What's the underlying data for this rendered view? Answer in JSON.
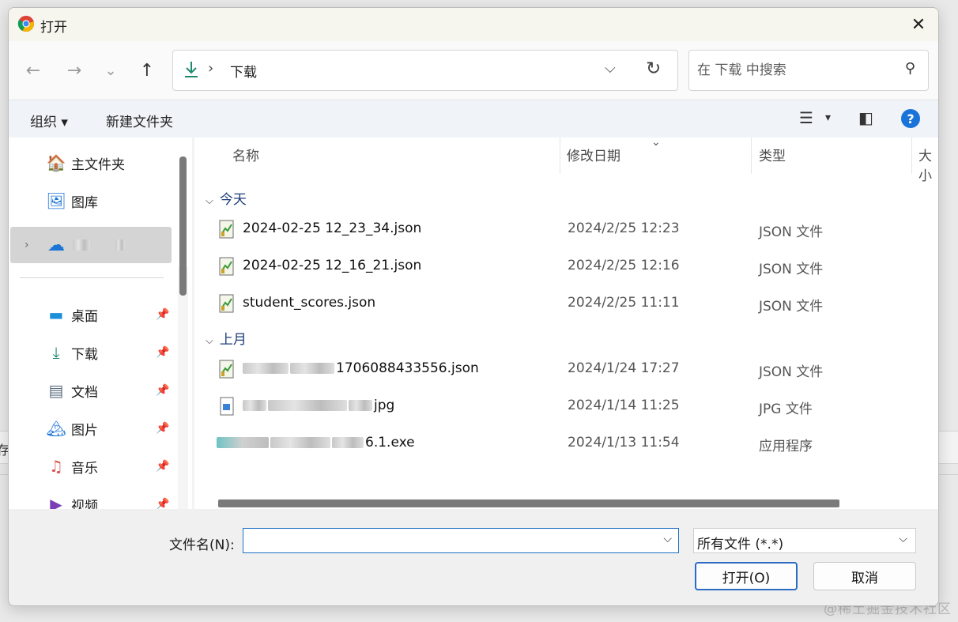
{
  "window": {
    "title": "打开",
    "close_glyph": "✕"
  },
  "nav": {
    "back_glyph": "←",
    "forward_glyph": "→",
    "recent_glyph": "⌄",
    "up_glyph": "↑",
    "address_sep": "›",
    "address_path": "下载",
    "address_drop": "⌵",
    "refresh_glyph": "↻",
    "search_placeholder": "在 下载 中搜索",
    "search_glyph": "⚲"
  },
  "toolbar": {
    "organize_label": "组织 ▾",
    "new_folder_label": "新建文件夹",
    "view_glyph": "☰",
    "view_drop": "▾",
    "preview_glyph": "◧",
    "help_glyph": "?"
  },
  "sidebar": {
    "items": [
      {
        "label": "主文件夹",
        "icon": "🏠"
      },
      {
        "label": "图库",
        "icon": "🖼"
      },
      {
        "label": "",
        "icon": "☁",
        "chevron": "›"
      },
      {
        "label": "桌面",
        "icon": "▬",
        "pin": "📌"
      },
      {
        "label": "下载",
        "icon": "⤓",
        "pin": "📌"
      },
      {
        "label": "文档",
        "icon": "▤",
        "pin": "📌"
      },
      {
        "label": "图片",
        "icon": "🏔",
        "pin": "📌"
      },
      {
        "label": "音乐",
        "icon": "♫",
        "pin": "📌"
      },
      {
        "label": "视频",
        "icon": "▶",
        "pin": "📌"
      }
    ]
  },
  "files": {
    "columns": [
      "名称",
      "修改日期",
      "类型",
      "大小"
    ],
    "sort_glyph": "⌄",
    "groups": [
      {
        "label": "今天",
        "chevron": "⌵"
      },
      {
        "label": "上月",
        "chevron": "⌵"
      }
    ],
    "rows": [
      {
        "name": "2024-02-25 12_23_34.json",
        "date": "2024/2/25 12:23",
        "type": "JSON 文件"
      },
      {
        "name": "2024-02-25 12_16_21.json",
        "date": "2024/2/25 12:16",
        "type": "JSON 文件"
      },
      {
        "name": "student_scores.json",
        "date": "2024/2/25 11:11",
        "type": "JSON 文件"
      },
      {
        "name": "1706088433556.json",
        "date": "2024/1/24 17:27",
        "type": "JSON 文件"
      },
      {
        "name": "jpg",
        "date": "2024/1/14 11:25",
        "type": "JPG 文件"
      },
      {
        "name": "6.1.exe",
        "date": "2024/1/13 11:54",
        "type": "应用程序"
      }
    ]
  },
  "footer": {
    "filename_label": "文件名(N):",
    "filename_value": "",
    "filetype_value": "所有文件 (*.*)",
    "dropdown_glyph": "⌵",
    "open_label": "打开(O)",
    "cancel_label": "取消"
  },
  "background": {
    "edge_char": "存",
    "watermark": "@稀土掘金技术社区"
  }
}
